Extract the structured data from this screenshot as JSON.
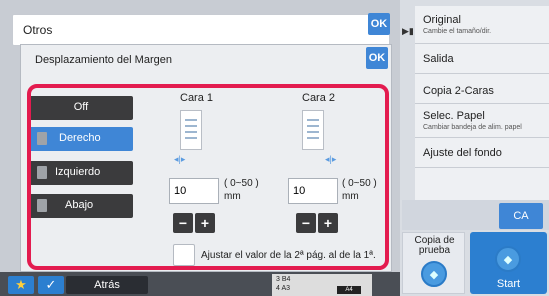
{
  "header": {
    "title": "Otros",
    "ok": "OK"
  },
  "dialog": {
    "title": "Desplazamiento del Margen",
    "ok": "OK"
  },
  "options": [
    {
      "label": "Off",
      "selected": false
    },
    {
      "label": "Derecho",
      "selected": true
    },
    {
      "label": "Izquierdo",
      "selected": false
    },
    {
      "label": "Abajo",
      "selected": false
    }
  ],
  "side1": {
    "label": "Cara 1",
    "value": "10",
    "range": "( 0~50 )",
    "unit": "mm"
  },
  "side2": {
    "label": "Cara 2",
    "value": "10",
    "range": "( 0~50 )",
    "unit": "mm"
  },
  "stepper": {
    "minus": "−",
    "plus": "+"
  },
  "adjust_checkbox": {
    "label": "Ajustar el valor de la 2ª pág. al de la 1ª.",
    "checked": false
  },
  "right_menu": [
    {
      "title": "Original",
      "subtitle": "Cambie el tamaño/dir."
    },
    {
      "title": "Salida",
      "subtitle": ""
    },
    {
      "title": "Copia 2-Caras",
      "subtitle": ""
    },
    {
      "title": "Selec. Papel",
      "subtitle": "Cambiar bandeja de alim. papel"
    },
    {
      "title": "Ajuste del fondo",
      "subtitle": ""
    }
  ],
  "bottom": {
    "back": "Atrás",
    "tray_rows": [
      "3   B4",
      "4   A3"
    ],
    "tray_current": "A4"
  },
  "actions": {
    "ca": "CA",
    "proof_copy": "Copia de prueba",
    "start": "Start"
  },
  "colors": {
    "accent": "#3f86d6",
    "highlight": "#e31b4f",
    "dark_button": "#3b3b3d"
  }
}
